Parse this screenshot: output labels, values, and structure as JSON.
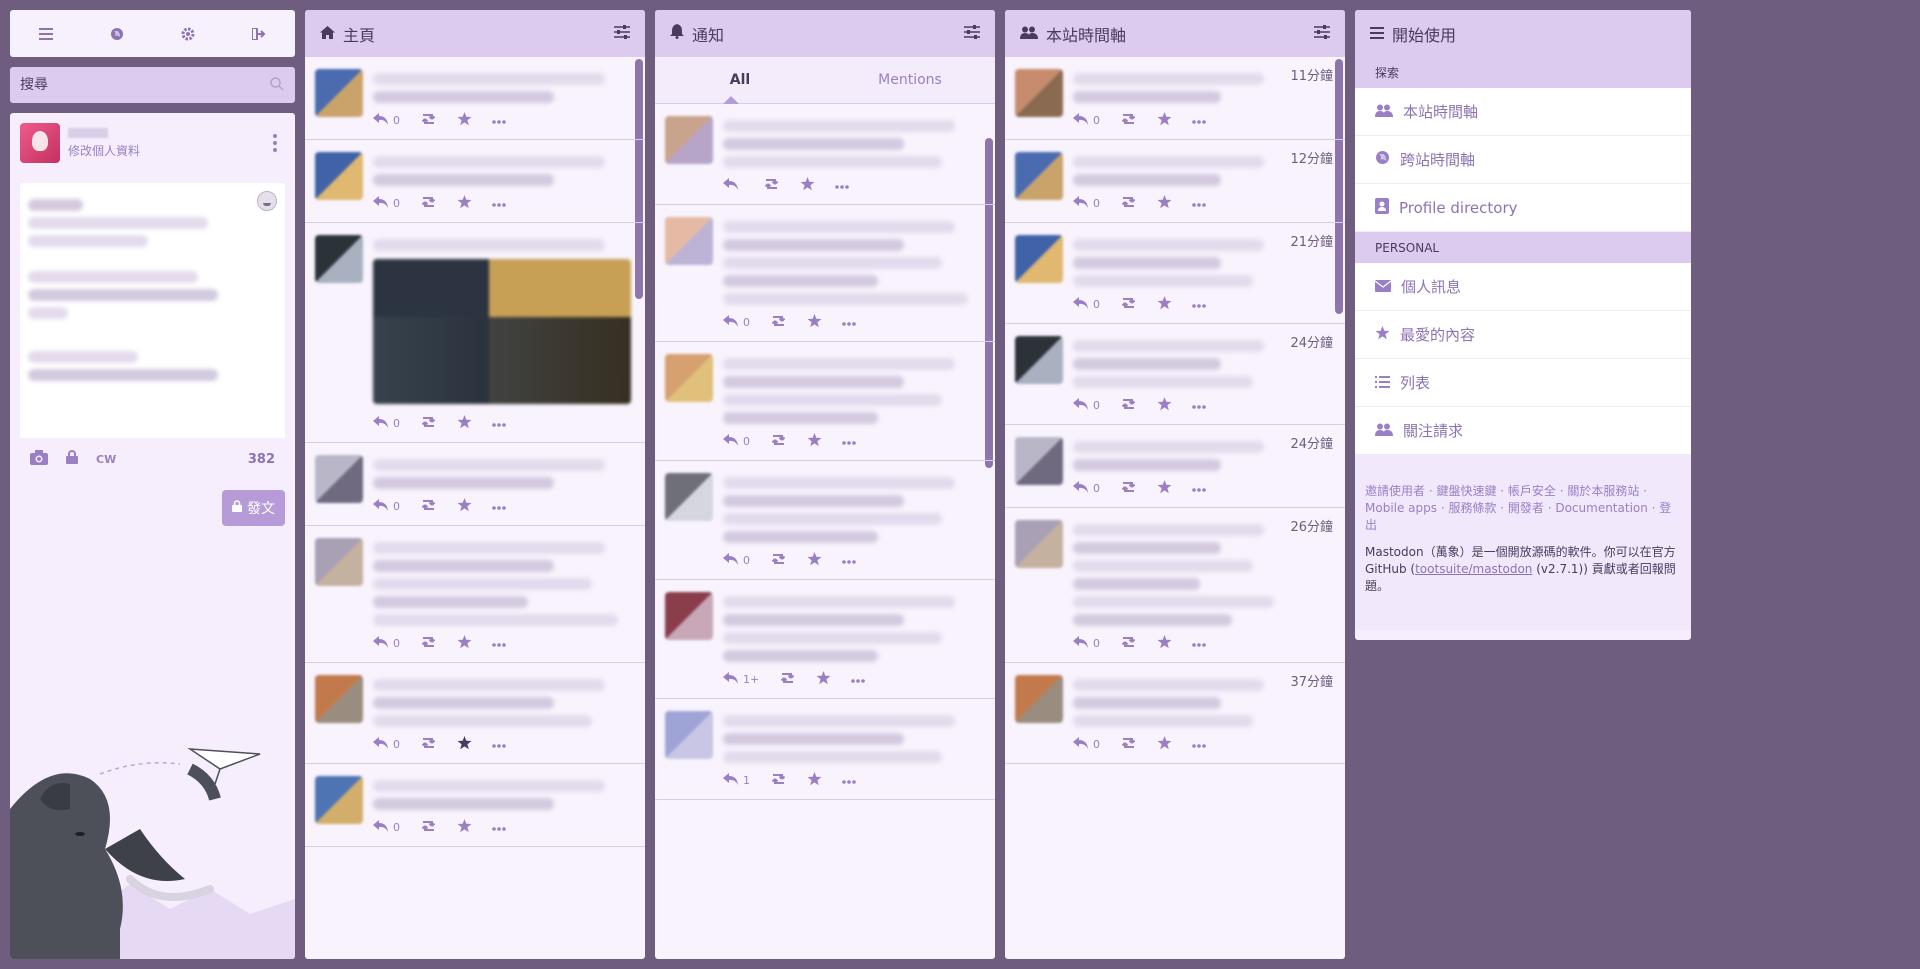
{
  "nav": {
    "icons": [
      "menu-icon",
      "globe-icon",
      "gear-icon",
      "logout-icon"
    ]
  },
  "search": {
    "placeholder": "搜尋"
  },
  "account": {
    "edit_profile": "修改個人資料"
  },
  "compose": {
    "cw_label": "CW",
    "char_count": "382",
    "publish_label": "發文"
  },
  "columns": {
    "home": {
      "title": "主頁"
    },
    "notifications": {
      "title": "通知",
      "tabs": [
        "All",
        "Mentions"
      ]
    },
    "local": {
      "title": "本站時間軸"
    }
  },
  "home_statuses": [
    {
      "reply_count": "0",
      "has_media": false,
      "lines": 2,
      "favourited": false
    },
    {
      "reply_count": "0",
      "has_media": false,
      "lines": 2,
      "favourited": false
    },
    {
      "reply_count": "0",
      "has_media": true,
      "lines": 1,
      "favourited": false
    },
    {
      "reply_count": "0",
      "has_media": false,
      "lines": 2,
      "favourited": false
    },
    {
      "reply_count": "0",
      "has_media": false,
      "lines": 5,
      "favourited": false
    },
    {
      "reply_count": "0",
      "has_media": false,
      "lines": 3,
      "favourited": true
    },
    {
      "reply_count": "0",
      "has_media": false,
      "lines": 2,
      "favourited": false
    }
  ],
  "notification_statuses": [
    {
      "reply_count": "",
      "lines": 3
    },
    {
      "reply_count": "0",
      "lines": 5
    },
    {
      "reply_count": "0",
      "lines": 4
    },
    {
      "reply_count": "0",
      "lines": 4
    },
    {
      "reply_count": "1+",
      "lines": 4
    },
    {
      "reply_count": "1",
      "lines": 3
    }
  ],
  "local_statuses": [
    {
      "time": "11分鐘",
      "reply_count": "0",
      "lines": 2
    },
    {
      "time": "12分鐘",
      "reply_count": "0",
      "lines": 2
    },
    {
      "time": "21分鐘",
      "reply_count": "0",
      "lines": 3
    },
    {
      "time": "24分鐘",
      "reply_count": "0",
      "lines": 3
    },
    {
      "time": "24分鐘",
      "reply_count": "0",
      "lines": 2
    },
    {
      "time": "26分鐘",
      "reply_count": "0",
      "lines": 6
    },
    {
      "time": "37分鐘",
      "reply_count": "0",
      "lines": 3
    }
  ],
  "getting_started": {
    "title": "開始使用",
    "discover_label": "探索",
    "discover_items": [
      {
        "label": "本站時間軸",
        "icon": "users-icon"
      },
      {
        "label": "跨站時間軸",
        "icon": "globe-icon"
      },
      {
        "label": "Profile directory",
        "icon": "address-book-icon"
      }
    ],
    "personal_label": "PERSONAL",
    "personal_items": [
      {
        "label": "個人訊息",
        "icon": "envelope-icon"
      },
      {
        "label": "最愛的內容",
        "icon": "star-icon"
      },
      {
        "label": "列表",
        "icon": "list-icon"
      },
      {
        "label": "關注請求",
        "icon": "users-icon"
      }
    ],
    "footer_links": "邀請使用者 · 鍵盤快速鍵 · 帳戶安全 · 關於本服務站 · Mobile apps · 服務條款 · 開發者 · Documentation · 登出",
    "about_prefix": "Mastodon（萬象）是一個開放源碼的軟件。你可以在官方 GitHub (",
    "about_link": "tootsuite/mastodon",
    "about_suffix": " (v2.7.1)) 貢獻或者回報問題。"
  },
  "colors": {
    "accent": "#9b7fc4",
    "header": "#dccbef",
    "background": "#6f5d80"
  }
}
